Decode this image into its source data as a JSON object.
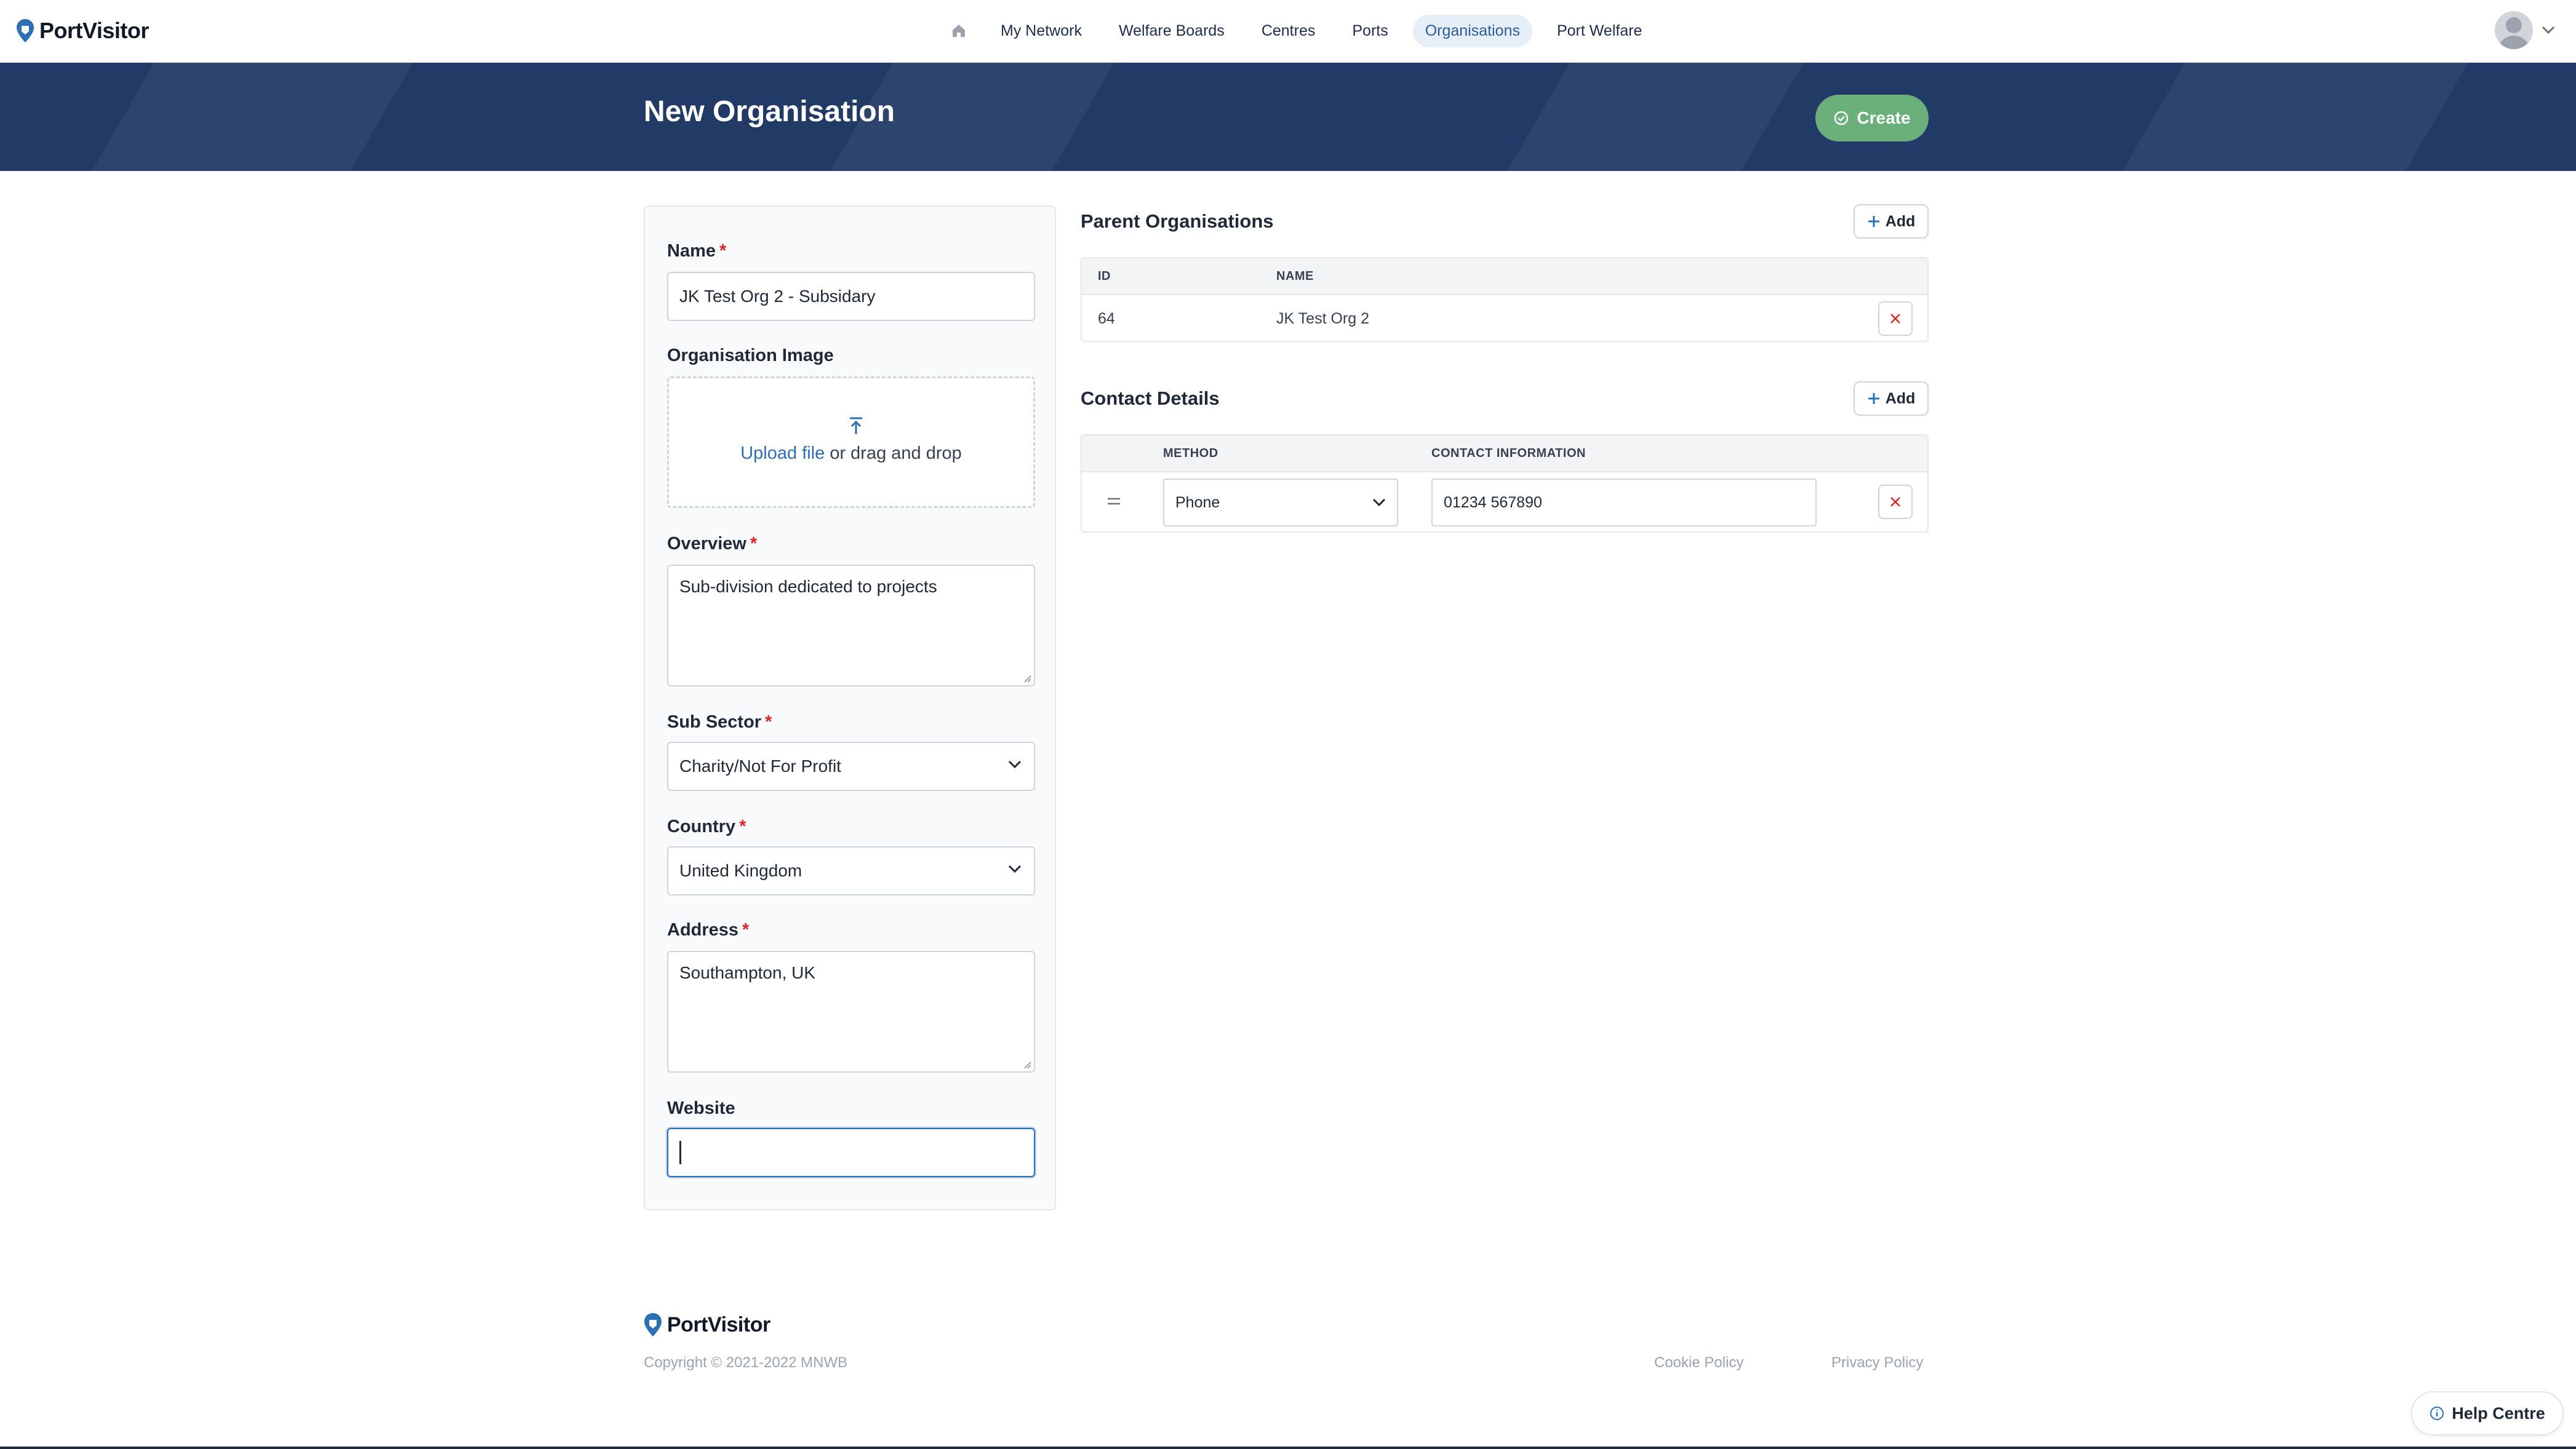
{
  "app": {
    "name": "PortVisitor"
  },
  "nav": {
    "items": [
      {
        "label": "My Network",
        "active": false
      },
      {
        "label": "Welfare Boards",
        "active": false
      },
      {
        "label": "Centres",
        "active": false
      },
      {
        "label": "Ports",
        "active": false
      },
      {
        "label": "Organisations",
        "active": true
      },
      {
        "label": "Port Welfare",
        "active": false
      }
    ]
  },
  "header": {
    "title": "New Organisation",
    "create_label": "Create"
  },
  "form": {
    "name": {
      "label": "Name",
      "value": "JK Test Org 2 - Subsidary"
    },
    "image": {
      "label": "Organisation Image",
      "upload_link": "Upload file",
      "upload_text": " or drag and drop"
    },
    "overview": {
      "label": "Overview",
      "value": "Sub-division dedicated to projects"
    },
    "sub_sector": {
      "label": "Sub Sector",
      "value": "Charity/Not For Profit"
    },
    "country": {
      "label": "Country",
      "value": "United Kingdom"
    },
    "address": {
      "label": "Address",
      "value": "Southampton, UK"
    },
    "website": {
      "label": "Website",
      "value": ""
    }
  },
  "parents": {
    "title": "Parent Organisations",
    "add_label": "Add",
    "columns": [
      "ID",
      "NAME"
    ],
    "rows": [
      {
        "id": "64",
        "name": "JK Test Org 2"
      }
    ]
  },
  "contacts": {
    "title": "Contact Details",
    "add_label": "Add",
    "columns": [
      "METHOD",
      "CONTACT INFORMATION"
    ],
    "rows": [
      {
        "method": "Phone",
        "info": "01234 567890"
      }
    ]
  },
  "footer": {
    "copyright": "Copyright © 2021-2022 MNWB",
    "cookie": "Cookie Policy",
    "privacy": "Privacy Policy",
    "help": "Help Centre"
  },
  "colors": {
    "brand_dark": "#223a66",
    "accent": "#2c6fb5",
    "create_green": "#6bb07a",
    "danger": "#dc2626"
  }
}
